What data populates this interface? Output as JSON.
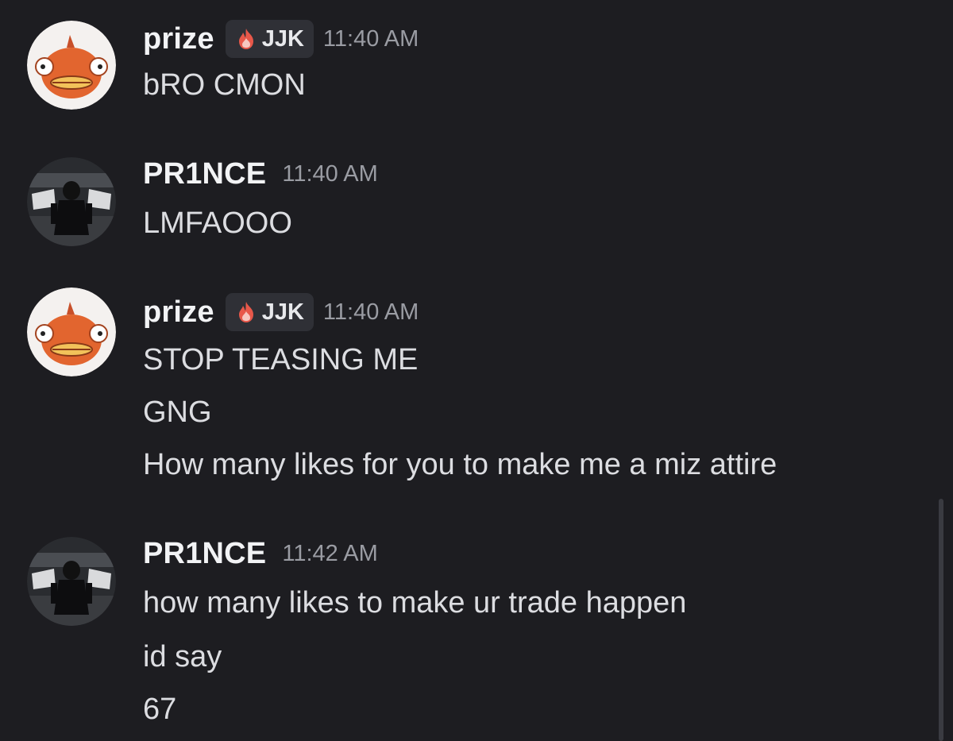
{
  "messages": [
    {
      "author": "prize",
      "tag": "JJK",
      "time": "11:40 AM",
      "avatar_icon": "fish-mascot-icon",
      "lines": [
        "bRO CMON"
      ]
    },
    {
      "author": "PR1NCE",
      "time": "11:40 AM",
      "avatar_icon": "dark-figure-avatar-icon",
      "lines": [
        "LMFAOOO"
      ]
    },
    {
      "author": "prize",
      "tag": "JJK",
      "time": "11:40 AM",
      "avatar_icon": "fish-mascot-icon",
      "lines": [
        "STOP TEASING ME",
        "GNG",
        "How many likes for you to make me a miz attire"
      ]
    },
    {
      "author": "PR1NCE",
      "time": "11:42 AM",
      "avatar_icon": "dark-figure-avatar-icon",
      "lines": [
        "how many likes to make ur trade happen",
        "id say",
        "67"
      ]
    }
  ],
  "colors": {
    "background": "#1d1d21",
    "username": "#f2f3f5",
    "message_text": "#dcdde1",
    "timestamp": "#9a9ca3",
    "tag_background": "#2f3036",
    "tag_icon": "#e8584a"
  }
}
